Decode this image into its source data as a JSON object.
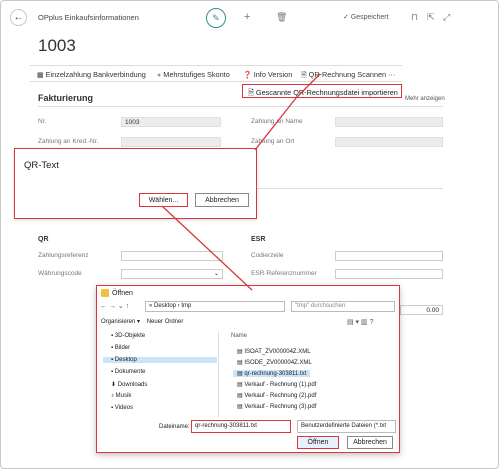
{
  "header": {
    "app_name": "OPplus Einkaufsinformationen",
    "edit_icon": "pencil-icon",
    "saved_label": "Gespeichert"
  },
  "page": {
    "title": "1003"
  },
  "actions": {
    "items": [
      {
        "label": "Einzelzahlung Bankverbindung",
        "icon": "table-icon"
      },
      {
        "label": "Mehrstufiges Skonto",
        "icon": "circle-icon"
      },
      {
        "label": "Info Version",
        "icon": "help-icon"
      },
      {
        "label": "QR-Rechnung Scannen",
        "icon": "document-icon"
      }
    ],
    "more": "···",
    "dropdown_item": "Gescannte QR-Rechnungsdatei importieren"
  },
  "fakturierung": {
    "title": "Fakturierung",
    "mehr_anzeigen": "Mehr anzeigen",
    "nr_label": "Nr.",
    "nr_value": "1003",
    "zahlung_kred_label": "Zahlung an Kred.-Nr.",
    "zahlung_name_label": "Zahlung an Name",
    "zahlung_ort_label": "Zahlung an Ort"
  },
  "qr_dialog": {
    "title": "QR-Text",
    "choose": "Wählen...",
    "cancel": "Abbrechen"
  },
  "qr": {
    "title": "QR",
    "zahlungsreferenz": "Zahlungsreferenz",
    "waehrungscode": "Währungscode"
  },
  "esr": {
    "title": "ESR",
    "codierzeile": "Codierzeile",
    "referenznummer": "ESR-Referenznummer",
    "amount": "0.00"
  },
  "open_dialog": {
    "title": "Öffnen",
    "path": "« Desktop › tmp",
    "search_placeholder": "\"tmp\" durchsuchen",
    "organize": "Organisieren ▾",
    "new_folder": "Neuer Ordner",
    "name_header": "Name",
    "tree": [
      "3D-Objekte",
      "Bilder",
      "Desktop",
      "Dokumente",
      "Downloads",
      "Musik",
      "Videos"
    ],
    "files": [
      "ISOAT_ZV000004Z.XML",
      "ISODE_ZV000004Z.XML",
      "qr-rechnung-303811.txt",
      "Verkauf - Rechnung (1).pdf",
      "Verkauf - Rechnung (2).pdf",
      "Verkauf - Rechnung (3).pdf"
    ],
    "filename_label": "Dateiname:",
    "filename_value": "qr-rechnung-303811.txt",
    "filter": "Benutzerdefinierte Dateien (*.txt",
    "open_btn": "Öffnen",
    "cancel_btn": "Abbrechen"
  },
  "colors": {
    "accent": "#d9363e",
    "teal": "#3c8c8c"
  }
}
